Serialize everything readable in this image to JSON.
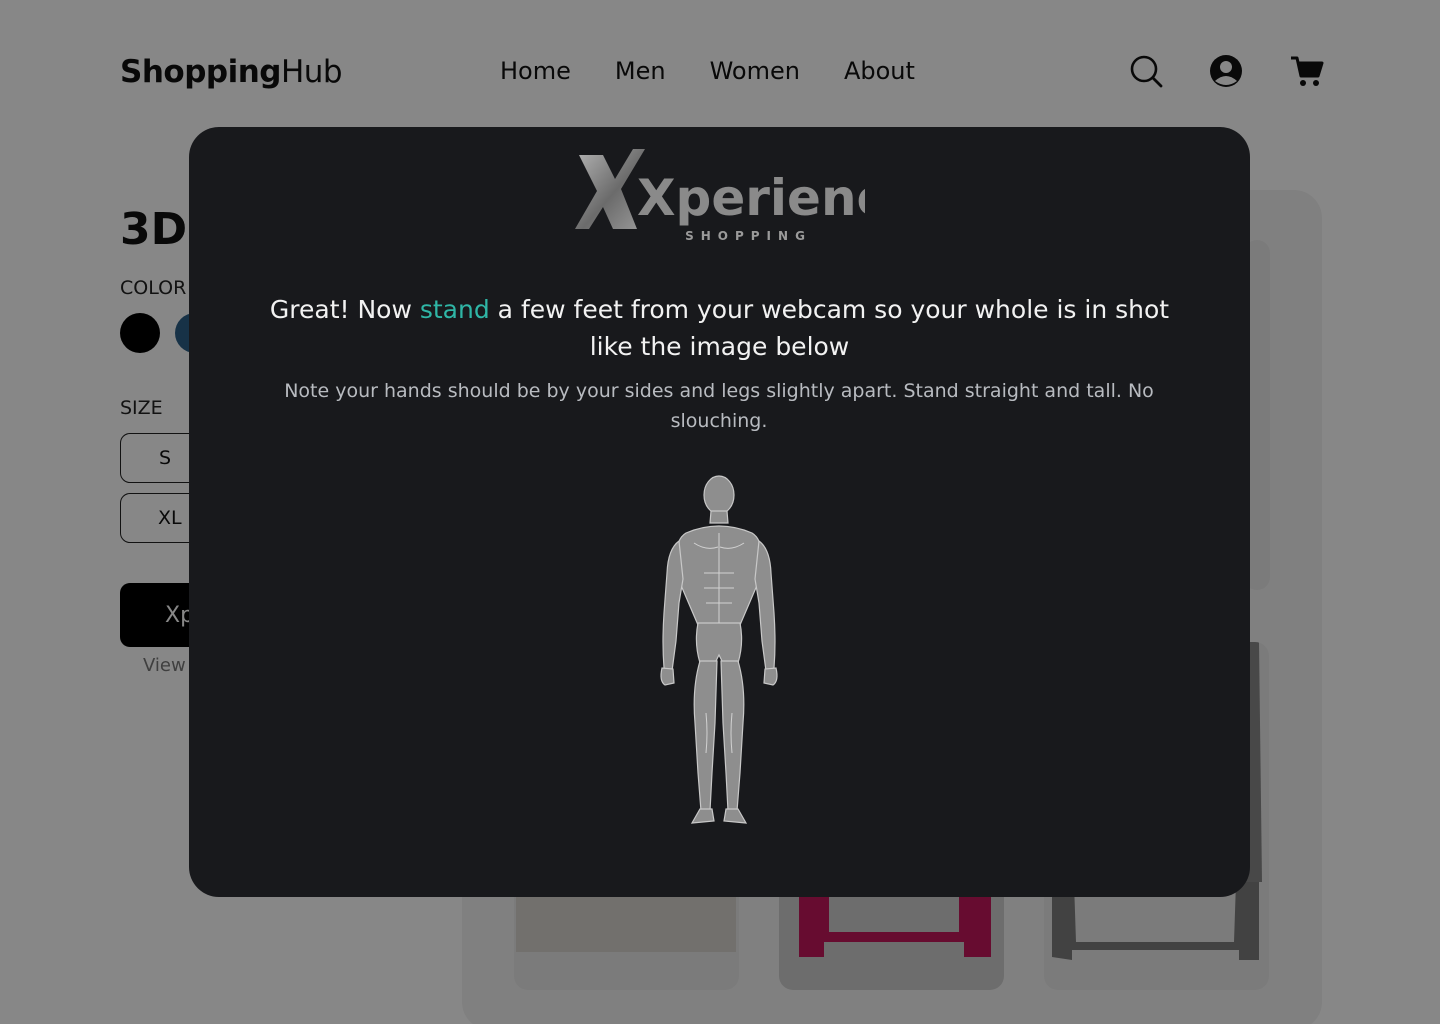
{
  "header": {
    "logo_bold": "Shopping",
    "logo_regular": "Hub",
    "nav": [
      "Home",
      "Men",
      "Women",
      "About"
    ],
    "icons": [
      "search-icon",
      "user-icon",
      "cart-icon"
    ]
  },
  "product": {
    "title_visible": "3D",
    "color_label_visible": "COLOR",
    "size_label": "SIZE",
    "sizes_visible": [
      "S",
      "XL"
    ],
    "cta_visible": "Xp",
    "view_visible": "View"
  },
  "modal": {
    "brand_name": "Xperience",
    "brand_sub": "SHOPPING",
    "headline_before": "Great! Now ",
    "headline_highlight": "stand",
    "headline_after": " a few feet from your webcam so your whole is in shot like the image below",
    "note": "Note your hands should be by your sides and legs slightly apart. Stand straight and tall. No slouching.",
    "figure_icon": "human-body-figure"
  },
  "colors": {
    "overlay": "rgba(0,0,0,0.47)",
    "modal_bg": "#18191c",
    "accent": "#2fb6a6",
    "swatch_black": "#000000",
    "swatch_blue": "#2c5f86"
  }
}
